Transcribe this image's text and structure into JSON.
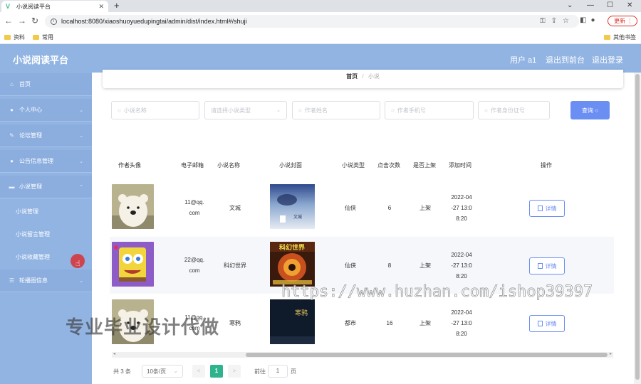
{
  "browser": {
    "tab_title": "小说阅读平台",
    "tab_favicon": "V",
    "url": "localhost:8080/xiaoshuoyuedupingtai/admin/dist/index.html#/shuji",
    "update_label": "更新",
    "bookmarks": [
      "资料",
      "常用"
    ],
    "other_bookmarks": "其他书签"
  },
  "header": {
    "title": "小说阅读平台",
    "user": "用户 a1",
    "back_to_front": "退出到前台",
    "logout": "退出登录"
  },
  "sidebar": {
    "items": [
      {
        "label": "首页",
        "icon": "home-icon"
      },
      {
        "label": "个人中心",
        "icon": "person-icon"
      },
      {
        "label": "论坛管理",
        "icon": "forum-icon"
      },
      {
        "label": "公告信息管理",
        "icon": "notice-icon"
      },
      {
        "label": "小说管理",
        "icon": "book-icon"
      },
      {
        "label": "轮播图信息",
        "icon": "list-icon"
      }
    ],
    "sub_items": [
      "小说管理",
      "小说留言管理",
      "小说收藏管理"
    ]
  },
  "breadcrumb": {
    "home": "首页",
    "separator": "/",
    "current": "小说"
  },
  "search": {
    "novel_name_placeholder": "小说名称",
    "novel_type_placeholder": "请选择小说类型",
    "author_name_placeholder": "作者姓名",
    "author_phone_placeholder": "作者手机号",
    "author_id_placeholder": "作者身份证号",
    "query_label": "查询"
  },
  "table": {
    "columns": [
      "作者头像",
      "电子邮箱",
      "小说名称",
      "小说封面",
      "小说类型",
      "点击次数",
      "是否上架",
      "添加时间",
      "操作"
    ],
    "rows": [
      {
        "email": [
          "11@qq.",
          "com"
        ],
        "name": "文城",
        "type": "仙侠",
        "clicks": "6",
        "status": "上架",
        "time": [
          "2022-04",
          "-27 13:0",
          "8:20"
        ],
        "action": "详情"
      },
      {
        "email": [
          "22@qq.",
          "com"
        ],
        "name": "科幻世界",
        "type": "仙侠",
        "clicks": "8",
        "status": "上架",
        "time": [
          "2022-04",
          "-27 13:0",
          "8:20"
        ],
        "action": "详情"
      },
      {
        "email": [
          "11@qq.",
          "com"
        ],
        "name": "寒鸦",
        "type": "都市",
        "clicks": "16",
        "status": "上架",
        "time": [
          "2022-04",
          "-27 13:0",
          "8:20"
        ],
        "action": "详情"
      }
    ]
  },
  "pagination": {
    "total": "共 3 条",
    "page_size": "10条/页",
    "prev": "<",
    "current_page": "1",
    "next": ">",
    "goto_prefix": "前往",
    "goto_value": "1",
    "goto_suffix": "页"
  },
  "covers": {
    "c1_title": "文城",
    "c2_title": "科幻世界",
    "c3_title": "寒鸦"
  },
  "watermarks": {
    "url": "https://www.huzhan.com/ishop39397",
    "text": "专业毕业设计代做"
  }
}
